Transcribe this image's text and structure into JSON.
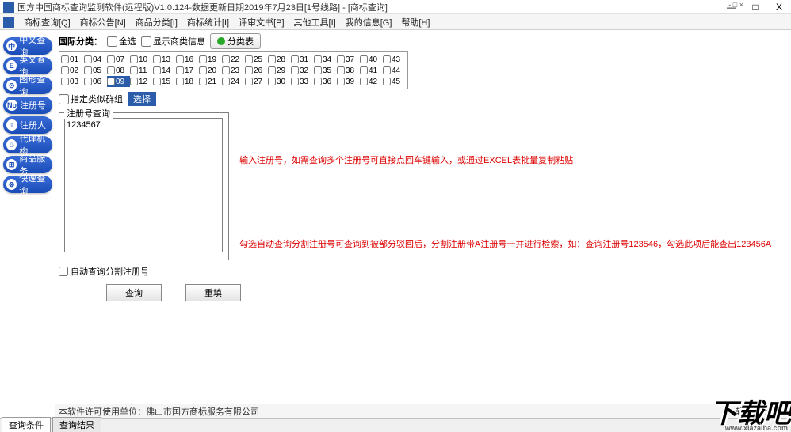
{
  "window": {
    "title": "国方中国商标查询监测软件(远程版)V1.0.124-数据更新日期2019年7月23日[1号线路] - [商标查询]",
    "min": "—",
    "restore": "□",
    "close": "X",
    "secondary_controls": "- □ ×"
  },
  "menu": [
    "商标查询[Q]",
    "商标公告[N]",
    "商品分类[I]",
    "商标统计[I]",
    "评审文书[P]",
    "其他工具[I]",
    "我的信息[G]",
    "帮助[H]"
  ],
  "sidebar": [
    {
      "icon": "中",
      "label": "中文查询"
    },
    {
      "icon": "E",
      "label": "英文查询"
    },
    {
      "icon": "⊙",
      "label": "图形查询"
    },
    {
      "icon": "No",
      "label": "注册号"
    },
    {
      "icon": "♀",
      "label": "注册人"
    },
    {
      "icon": "☺",
      "label": "代理机构"
    },
    {
      "icon": "⊞",
      "label": "商品服务"
    },
    {
      "icon": "⊗",
      "label": "快速查询"
    }
  ],
  "classify": {
    "label": "国际分类：",
    "all": "全选",
    "showinfo": "显示商类信息",
    "tablebtn": "分类表"
  },
  "classes": {
    "rows": [
      [
        "01",
        "04",
        "07",
        "10",
        "13",
        "16",
        "19",
        "22",
        "25",
        "28",
        "31",
        "34",
        "37",
        "40",
        "43"
      ],
      [
        "02",
        "05",
        "08",
        "11",
        "14",
        "17",
        "20",
        "23",
        "26",
        "29",
        "32",
        "35",
        "38",
        "41",
        "44"
      ],
      [
        "03",
        "06",
        "09",
        "12",
        "15",
        "18",
        "21",
        "24",
        "27",
        "30",
        "33",
        "36",
        "39",
        "42",
        "45"
      ]
    ],
    "selected": "09"
  },
  "group": {
    "chk": "指定类似群组",
    "btn": "选择"
  },
  "fieldset": {
    "legend": "注册号查询",
    "value": "1234567"
  },
  "hints": {
    "h1": "输入注册号，如需查询多个注册号可直接点回车键输入，或通过EXCEL表批量复制粘贴",
    "h2": "勾选自动查询分割注册号可查询到被部分驳回后，分割注册带A注册号一并进行检索，如：查询注册号123546，勾选此项后能查出123456A"
  },
  "auto": "自动查询分割注册号",
  "buttons": {
    "query": "查询",
    "reset": "重填"
  },
  "footer": {
    "left": "本软件许可使用单位：佛山市国方商标服务有限公司",
    "right": "软件服务热线"
  },
  "tabs": {
    "t1": "查询条件",
    "t2": "查询结果"
  },
  "watermark": {
    "main": "下载吧",
    "sub": "www.xiazaiba.com"
  }
}
